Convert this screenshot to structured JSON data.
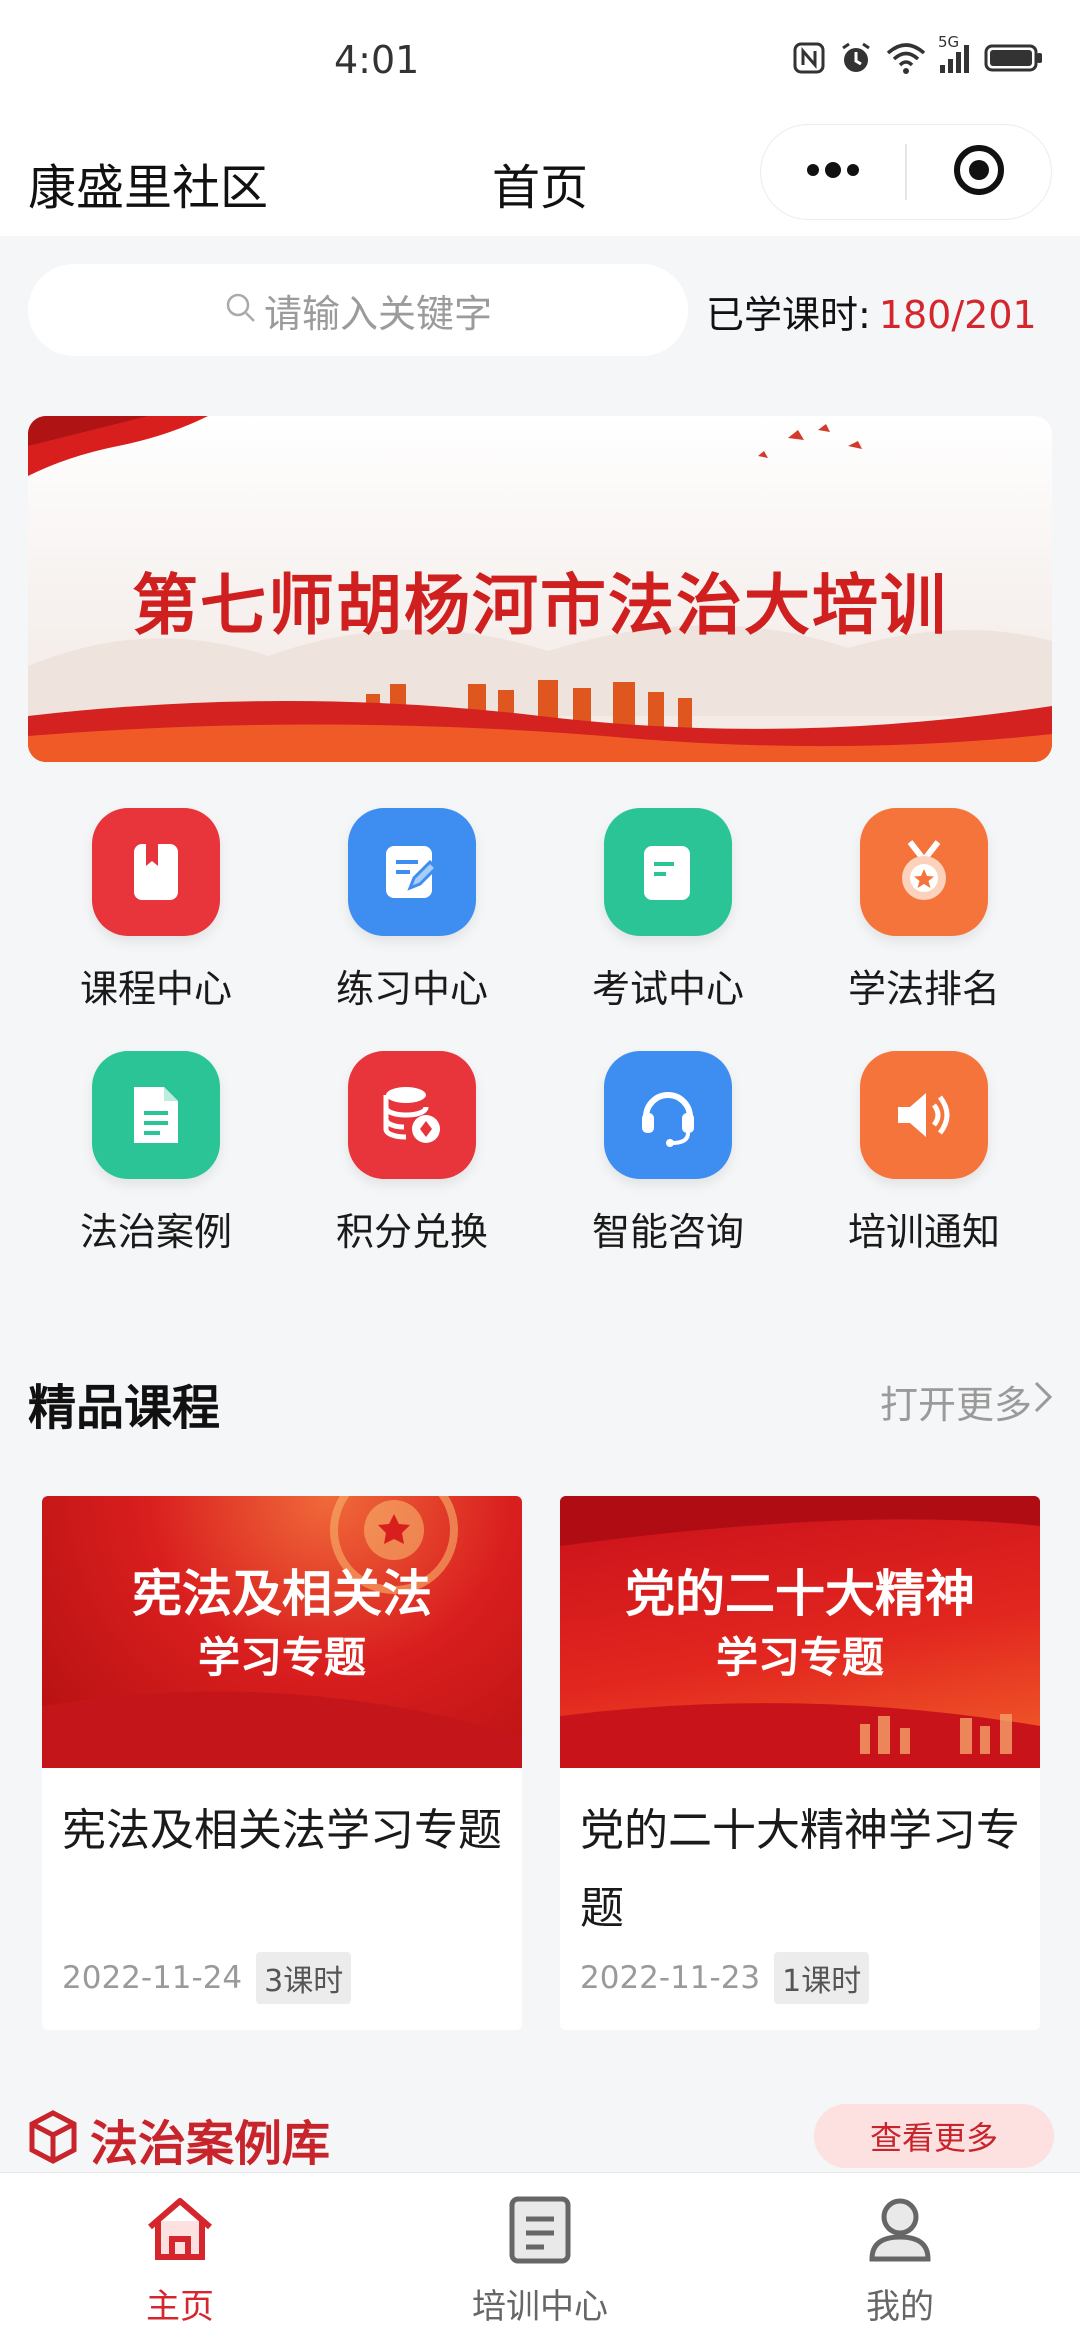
{
  "status_bar": {
    "time": "4:01",
    "icons": [
      "nfc-icon",
      "alarm-icon",
      "wifi-icon",
      "signal-5g-icon",
      "battery-icon"
    ],
    "network_label": "5G"
  },
  "nav": {
    "community": "康盛里社区",
    "title": "首页",
    "menu_icon": "more-dots-icon",
    "close_icon": "target-icon"
  },
  "search": {
    "placeholder": "请输入关键字",
    "icon": "search-icon"
  },
  "learned": {
    "label": "已学课时:",
    "value": "180/201"
  },
  "banner": {
    "text": "第七师胡杨河市法治大培训"
  },
  "menu": [
    {
      "label": "课程中心",
      "icon": "bookmark-book-icon",
      "color": "#e8343b"
    },
    {
      "label": "练习中心",
      "icon": "edit-note-icon",
      "color": "#3d8ef0"
    },
    {
      "label": "考试中心",
      "icon": "document-icon",
      "color": "#2bc497"
    },
    {
      "label": "学法排名",
      "icon": "medal-icon",
      "color": "#f5743b"
    },
    {
      "label": "法治案例",
      "icon": "file-text-icon",
      "color": "#2bc497"
    },
    {
      "label": "积分兑换",
      "icon": "coins-database-icon",
      "color": "#e8343b"
    },
    {
      "label": "智能咨询",
      "icon": "headset-icon",
      "color": "#3d8ef0"
    },
    {
      "label": "培训通知",
      "icon": "speaker-icon",
      "color": "#f5743b"
    }
  ],
  "featured": {
    "title": "精品课程",
    "more": "打开更多"
  },
  "courses": [
    {
      "cover_line1": "宪法及相关法",
      "cover_line2": "学习专题",
      "title": "宪法及相关法学习专题",
      "date": "2022-11-24",
      "tag": "3课时"
    },
    {
      "cover_line1": "党的二十大精神",
      "cover_line2": "学习专题",
      "title": "党的二十大精神学习专题",
      "date": "2022-11-23",
      "tag": "1课时"
    }
  ],
  "cases": {
    "title": "法治案例库",
    "more": "查看更多",
    "icon": "cube-icon"
  },
  "tabs": [
    {
      "label": "主页",
      "icon": "home-icon",
      "active": true
    },
    {
      "label": "培训中心",
      "icon": "training-doc-icon",
      "active": false
    },
    {
      "label": "我的",
      "icon": "user-icon",
      "active": false
    }
  ],
  "colors": {
    "accent": "#d6262d",
    "background": "#f5f6f7"
  }
}
